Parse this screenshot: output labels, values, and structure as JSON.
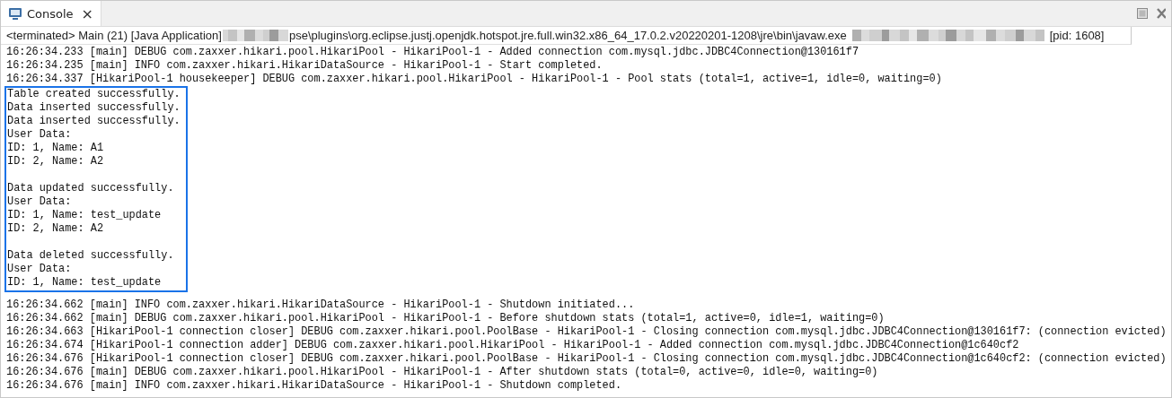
{
  "tab": {
    "label": "Console",
    "close": "×",
    "selected": true
  },
  "process_line": {
    "prefix": "<terminated> Main (21) [Java Application]",
    "path": "pse\\plugins\\org.eclipse.justj.openjdk.hotspot.jre.full.win32.x86_64_17.0.2.v20220201-1208\\jre\\bin\\javaw.exe",
    "pid": "[pid: 1608]"
  },
  "log_before": [
    "16:26:34.233 [main] DEBUG com.zaxxer.hikari.pool.HikariPool - HikariPool-1 - Added connection com.mysql.jdbc.JDBC4Connection@130161f7",
    "16:26:34.235 [main] INFO com.zaxxer.hikari.HikariDataSource - HikariPool-1 - Start completed.",
    "16:26:34.337 [HikariPool-1 housekeeper] DEBUG com.zaxxer.hikari.pool.HikariPool - HikariPool-1 - Pool stats (total=1, active=1, idle=0, waiting=0)"
  ],
  "highlighted_blocks": [
    [
      "Table created successfully.",
      "Data inserted successfully.",
      "Data inserted successfully.",
      "User Data:",
      "ID: 1, Name: A1",
      "ID: 2, Name: A2"
    ],
    [
      "Data updated successfully.",
      "User Data:",
      "ID: 1, Name: test_update",
      "ID: 2, Name: A2"
    ],
    [
      "Data deleted successfully.",
      "User Data:",
      "ID: 1, Name: test_update"
    ]
  ],
  "log_after": [
    "16:26:34.662 [main] INFO com.zaxxer.hikari.HikariDataSource - HikariPool-1 - Shutdown initiated...",
    "16:26:34.662 [main] DEBUG com.zaxxer.hikari.pool.HikariPool - HikariPool-1 - Before shutdown stats (total=1, active=0, idle=1, waiting=0)",
    "16:26:34.663 [HikariPool-1 connection closer] DEBUG com.zaxxer.hikari.pool.PoolBase - HikariPool-1 - Closing connection com.mysql.jdbc.JDBC4Connection@130161f7: (connection evicted)",
    "16:26:34.674 [HikariPool-1 connection adder] DEBUG com.zaxxer.hikari.pool.HikariPool - HikariPool-1 - Added connection com.mysql.jdbc.JDBC4Connection@1c640cf2",
    "16:26:34.676 [HikariPool-1 connection closer] DEBUG com.zaxxer.hikari.pool.PoolBase - HikariPool-1 - Closing connection com.mysql.jdbc.JDBC4Connection@1c640cf2: (connection evicted)",
    "16:26:34.676 [main] DEBUG com.zaxxer.hikari.pool.HikariPool - HikariPool-1 - After shutdown stats (total=0, active=0, idle=0, waiting=0)",
    "16:26:34.676 [main] INFO com.zaxxer.hikari.HikariDataSource - HikariPool-1 - Shutdown completed."
  ]
}
